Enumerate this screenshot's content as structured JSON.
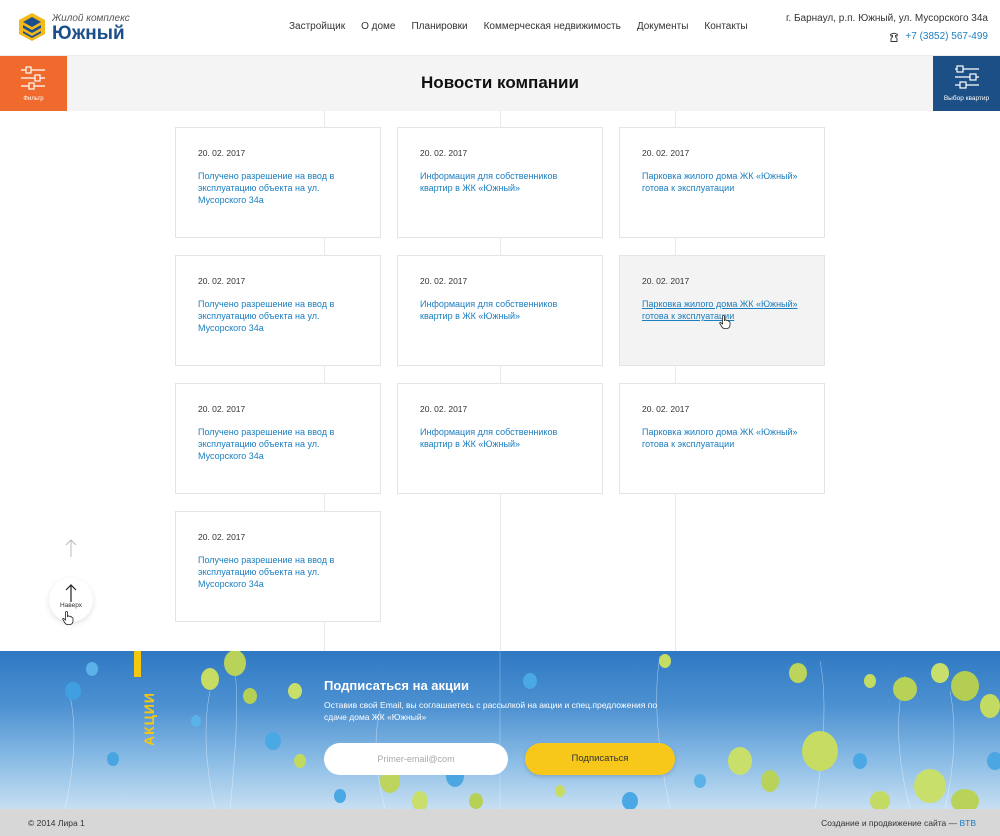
{
  "header": {
    "logo_subtitle": "Жилой комплекс",
    "logo_title": "Южный",
    "nav": [
      "Застройщик",
      "О доме",
      "Планировки",
      "Коммерческая недвижимость",
      "Документы",
      "Контакты"
    ],
    "address": "г. Барнаул, р.п. Южный, ул. Мусорского 34а",
    "phone": "+7 (3852) 567-499",
    "brand_color": "#1b4f8c",
    "accent_color": "#1a7ec0"
  },
  "title_band": {
    "title": "Новости компании",
    "filter_label": "Фильтр",
    "filter_color": "#ef6a2c",
    "apartment_label": "Выбор квартир",
    "apartment_color": "#1c4f85"
  },
  "news": [
    {
      "date": "20. 02. 2017",
      "title": "Получено разрешение на ввод в эксплуатацию объекта на ул. Мусорского 34а"
    },
    {
      "date": "20. 02. 2017",
      "title": "Информация для собственников квартир в ЖК «Южный»"
    },
    {
      "date": "20. 02. 2017",
      "title": "Парковка жилого дома ЖК «Южный» готова к эксплуатации"
    },
    {
      "date": "20. 02. 2017",
      "title": "Получено разрешение на ввод в эксплуатацию объекта на ул. Мусорского 34а"
    },
    {
      "date": "20. 02. 2017",
      "title": "Информация для собственников квартир в ЖК «Южный»"
    },
    {
      "date": "20. 02. 2017",
      "title": "Парковка жилого дома ЖК «Южный» готова к эксплуатации",
      "hovered": true
    },
    {
      "date": "20. 02. 2017",
      "title": "Получено разрешение на ввод в эксплуатацию объекта на ул. Мусорского 34а"
    },
    {
      "date": "20. 02. 2017",
      "title": "Информация для собственников квартир в ЖК «Южный»"
    },
    {
      "date": "20. 02. 2017",
      "title": "Парковка жилого дома ЖК «Южный» готова к эксплуатации"
    },
    {
      "date": "20. 02. 2017",
      "title": "Получено разрешение на ввод в эксплуатацию объекта на ул. Мусорского 34а"
    }
  ],
  "scroll_top": {
    "label": "Наверх"
  },
  "subscribe": {
    "side_label": "АКЦИИ",
    "title": "Подписаться на акции",
    "description": "Оставив свой Email, вы соглашаетесь с рассылкой на акции и спец.предложения по сдаче дома ЖК «Южный»",
    "email_placeholder": "Primer-email@com",
    "button_label": "Подписаться",
    "button_color": "#f7c81a",
    "side_label_color": "#f5c70f"
  },
  "footer": {
    "copyright": "© 2014 Лира 1",
    "credit_text": "Создание и продвижение сайта —",
    "credit_link": "BTB"
  }
}
